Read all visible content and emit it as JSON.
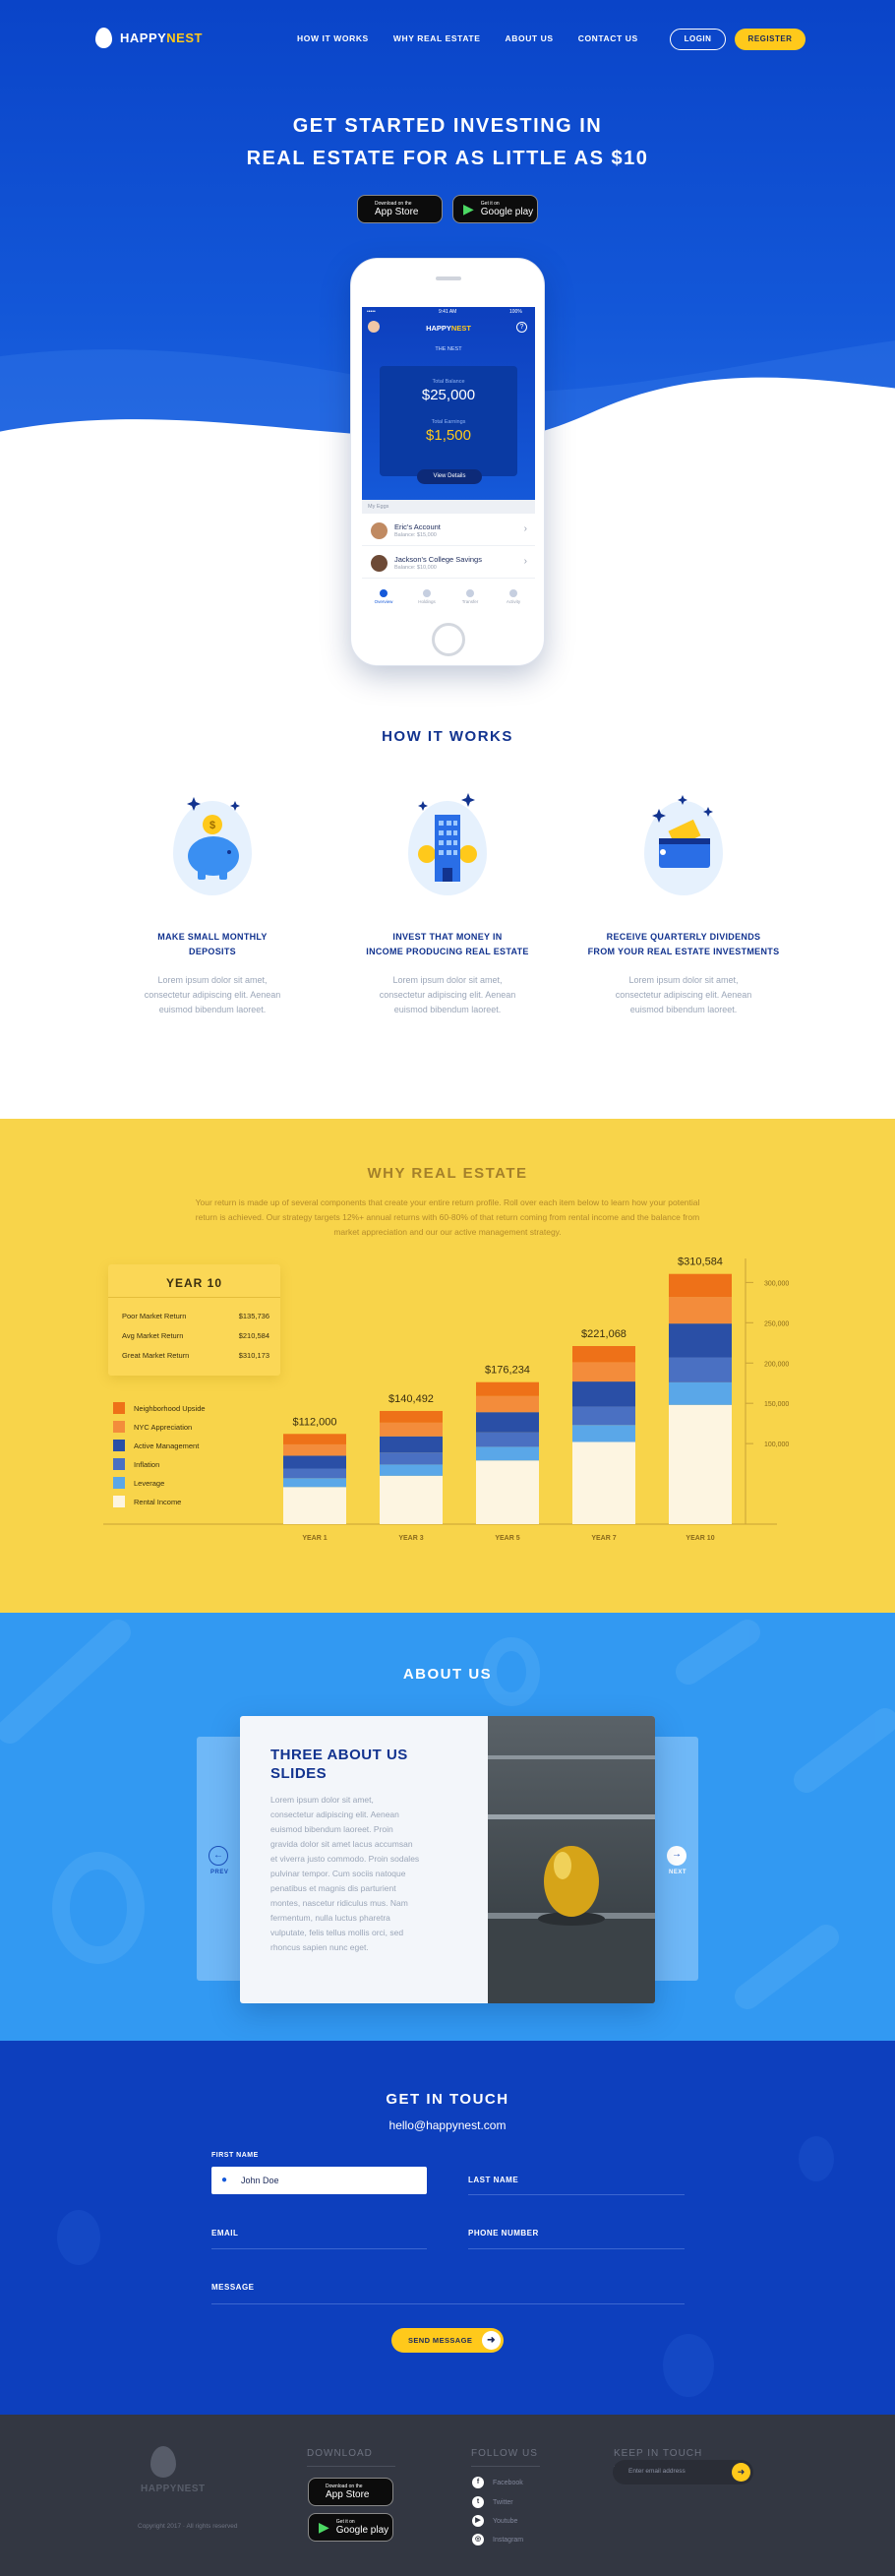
{
  "nav": {
    "logo_a": "HAPPY",
    "logo_b": "NEST",
    "links": [
      "HOW IT WORKS",
      "WHY REAL ESTATE",
      "ABOUT US",
      "CONTACT US"
    ],
    "login": "LOGIN",
    "register": "REGISTER"
  },
  "hero": {
    "title_1": "GET STARTED INVESTING IN",
    "title_2": "REAL ESTATE FOR AS LITTLE AS $10",
    "appstore_small": "Download on the",
    "appstore": "App Store",
    "gplay_small": "Get it on",
    "gplay": "Google play"
  },
  "phone": {
    "carrier": "•••••",
    "time": "9:41 AM",
    "battery": "100%",
    "nest_label": "THE NEST",
    "total_balance_label": "Total Balance",
    "total_balance": "$25,000",
    "total_earnings_label": "Total Earnings",
    "total_earnings": "$1,500",
    "view_details": "View Details",
    "my_eggs": "My Eggs",
    "accounts": [
      {
        "name": "Eric's Account",
        "balance": "Balance: $15,000"
      },
      {
        "name": "Jackson's College Savings",
        "balance": "Balance: $10,000"
      }
    ],
    "tabs": [
      "Overview",
      "Holdings",
      "Transfer",
      "Activity"
    ]
  },
  "how": {
    "title": "HOW IT WORKS",
    "items": [
      {
        "title_1": "MAKE SMALL MONTHLY",
        "title_2": "DEPOSITS",
        "text_1": "Lorem ipsum dolor sit amet,",
        "text_2": "consectetur adipiscing elit. Aenean",
        "text_3": "euismod bibendum laoreet."
      },
      {
        "title_1": "INVEST THAT MONEY IN",
        "title_2": "INCOME PRODUCING REAL ESTATE",
        "text_1": "Lorem ipsum dolor sit amet,",
        "text_2": "consectetur adipiscing elit. Aenean",
        "text_3": "euismod bibendum laoreet."
      },
      {
        "title_1": "RECEIVE QUARTERLY DIVIDENDS",
        "title_2": "FROM YOUR REAL ESTATE INVESTMENTS",
        "text_1": "Lorem ipsum dolor sit amet,",
        "text_2": "consectetur adipiscing elit. Aenean",
        "text_3": "euismod bibendum laoreet."
      }
    ]
  },
  "why": {
    "title": "WHY REAL ESTATE",
    "intro_1": "Your return is made up of several components that create your entire return profile. Roll over each item below to learn how your potential",
    "intro_2": "return is achieved. Our strategy targets 12%+ annual returns with 60-80% of that return coming from rental income and the balance from",
    "intro_3": "market appreciation and our our active management strategy.",
    "year_card": {
      "title": "YEAR 10",
      "rows": [
        {
          "label": "Poor Market Return",
          "value": "$135,736"
        },
        {
          "label": "Avg Market Return",
          "value": "$210,584"
        },
        {
          "label": "Great Market Return",
          "value": "$310,173"
        }
      ]
    }
  },
  "chart_data": {
    "type": "bar",
    "stacked": true,
    "categories": [
      "YEAR 1",
      "YEAR 3",
      "YEAR 5",
      "YEAR 7",
      "YEAR 10"
    ],
    "totals_labels": [
      "$112,000",
      "$140,492",
      "$176,234",
      "$221,068",
      "$310,584"
    ],
    "totals": [
      112000,
      140492,
      176234,
      221068,
      310584
    ],
    "y_ticks": [
      "100,000",
      "150,000",
      "200,000",
      "250,000",
      "300,000"
    ],
    "ylim": [
      0,
      320000
    ],
    "series": [
      {
        "name": "Rental Income",
        "color": "#fdf5e1",
        "values": [
          46000,
          60000,
          79000,
          102000,
          148000
        ]
      },
      {
        "name": "Leverage",
        "color": "#5aa7e8",
        "values": [
          11000,
          14000,
          17000,
          21000,
          28000
        ]
      },
      {
        "name": "Inflation",
        "color": "#4a70c2",
        "values": [
          12000,
          15000,
          18000,
          23000,
          31000
        ]
      },
      {
        "name": "Active Management",
        "color": "#2a4fa6",
        "values": [
          16000,
          20000,
          25000,
          31000,
          42000
        ]
      },
      {
        "name": "NYC Appreciation",
        "color": "#f38c3b",
        "values": [
          14000,
          17000,
          20000,
          24000,
          33000
        ]
      },
      {
        "name": "Neighborhood Upside",
        "color": "#ee7118",
        "values": [
          13000,
          14492,
          17234,
          20068,
          28584
        ]
      }
    ],
    "legend_order": [
      "Neighborhood Upside",
      "NYC Appreciation",
      "Active Management",
      "Inflation",
      "Leverage",
      "Rental Income"
    ]
  },
  "about": {
    "title": "ABOUT US",
    "card_title_1": "THREE ABOUT US",
    "card_title_2": "SLIDES",
    "lines": [
      "Lorem ipsum dolor sit amet,",
      "consectetur adipiscing elit. Aenean",
      "euismod bibendum laoreet. Proin",
      "gravida dolor sit amet lacus accumsan",
      "et viverra justo commodo. Proin sodales",
      "pulvinar tempor. Cum sociis natoque",
      "penatibus et magnis dis parturient",
      "montes, nascetur ridiculus mus. Nam",
      "fermentum, nulla luctus pharetra",
      "vulputate, felis tellus mollis orci, sed",
      "rhoncus sapien nunc eget."
    ],
    "prev": "PREV",
    "next": "NEXT"
  },
  "contact": {
    "title": "GET IN TOUCH",
    "email": "hello@happynest.com",
    "first_name_label": "FIRST NAME",
    "first_name_value": "John Doe",
    "last_name_label": "LAST NAME",
    "email_label": "EMAIL",
    "phone_label": "PHONE NUMBER",
    "message_label": "MESSAGE",
    "send": "SEND MESSAGE"
  },
  "footer": {
    "logo_a": "HAPPY",
    "logo_b": "NEST",
    "copyright": "Copyright 2017 · All rights reserved",
    "download": "DOWNLOAD",
    "follow": "FOLLOW US",
    "keep": "KEEP IN TOUCH",
    "socials": [
      "Facebook",
      "Twitter",
      "Youtube",
      "Instagram"
    ],
    "email_placeholder": "Enter email address"
  },
  "colors": {
    "brand_blue": "#0d3fbd",
    "accent_yellow": "#ffc91b",
    "why_bg": "#f8d44a",
    "about_bg": "#3299f2",
    "footer_bg": "#333742"
  }
}
